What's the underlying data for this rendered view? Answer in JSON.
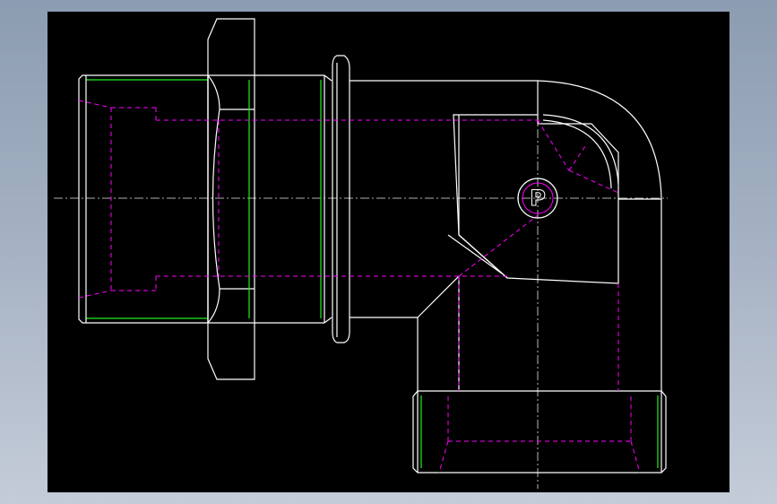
{
  "viewport": {
    "background": "#000000",
    "frame_background": "#a3b0c2"
  },
  "line_colors": {
    "visible_edges": "#ffffff",
    "thread_edges": "#22ee22",
    "hidden_edges": "#ff00ff",
    "center_lines": "#e8e8e8"
  },
  "logo": {
    "letter": "P"
  }
}
